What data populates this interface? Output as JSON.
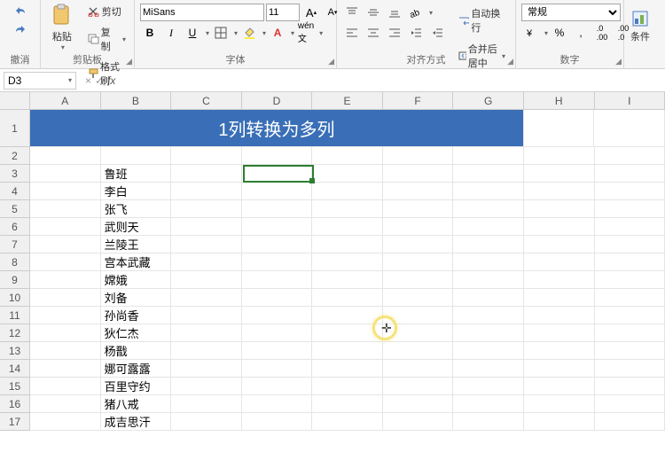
{
  "ribbon": {
    "undo": {
      "label": "撤消"
    },
    "clipboard": {
      "label": "剪贴板",
      "paste": "粘贴",
      "cut": "剪切",
      "copy": "复制",
      "format_painter": "格式刷"
    },
    "font": {
      "label": "字体",
      "name": "MiSans",
      "size": "11",
      "bold": "B",
      "italic": "I",
      "underline": "U",
      "inc": "A",
      "dec": "A"
    },
    "align": {
      "label": "对齐方式",
      "wrap": "自动换行",
      "merge": "合并后居中"
    },
    "number": {
      "label": "数字",
      "format": "常规"
    },
    "cond": {
      "label": "条件"
    }
  },
  "fbar": {
    "ref": "D3",
    "cancel": "×",
    "ok": "✓",
    "fx": "fx",
    "formula": ""
  },
  "sheet": {
    "cols": [
      "A",
      "B",
      "C",
      "D",
      "E",
      "F",
      "G",
      "H",
      "I"
    ],
    "title": "1列转换为多列",
    "rows": [
      {
        "n": "1"
      },
      {
        "n": "2"
      },
      {
        "n": "3",
        "b": "鲁班"
      },
      {
        "n": "4",
        "b": "李白"
      },
      {
        "n": "5",
        "b": "张飞"
      },
      {
        "n": "6",
        "b": "武则天"
      },
      {
        "n": "7",
        "b": "兰陵王"
      },
      {
        "n": "8",
        "b": "宫本武藏"
      },
      {
        "n": "9",
        "b": "嫦娥"
      },
      {
        "n": "10",
        "b": "刘备"
      },
      {
        "n": "11",
        "b": "孙尚香"
      },
      {
        "n": "12",
        "b": "狄仁杰"
      },
      {
        "n": "13",
        "b": "杨戬"
      },
      {
        "n": "14",
        "b": "娜可露露"
      },
      {
        "n": "15",
        "b": "百里守约"
      },
      {
        "n": "16",
        "b": "猪八戒"
      },
      {
        "n": "17",
        "b": "成吉思汗"
      }
    ],
    "active": "D3"
  }
}
